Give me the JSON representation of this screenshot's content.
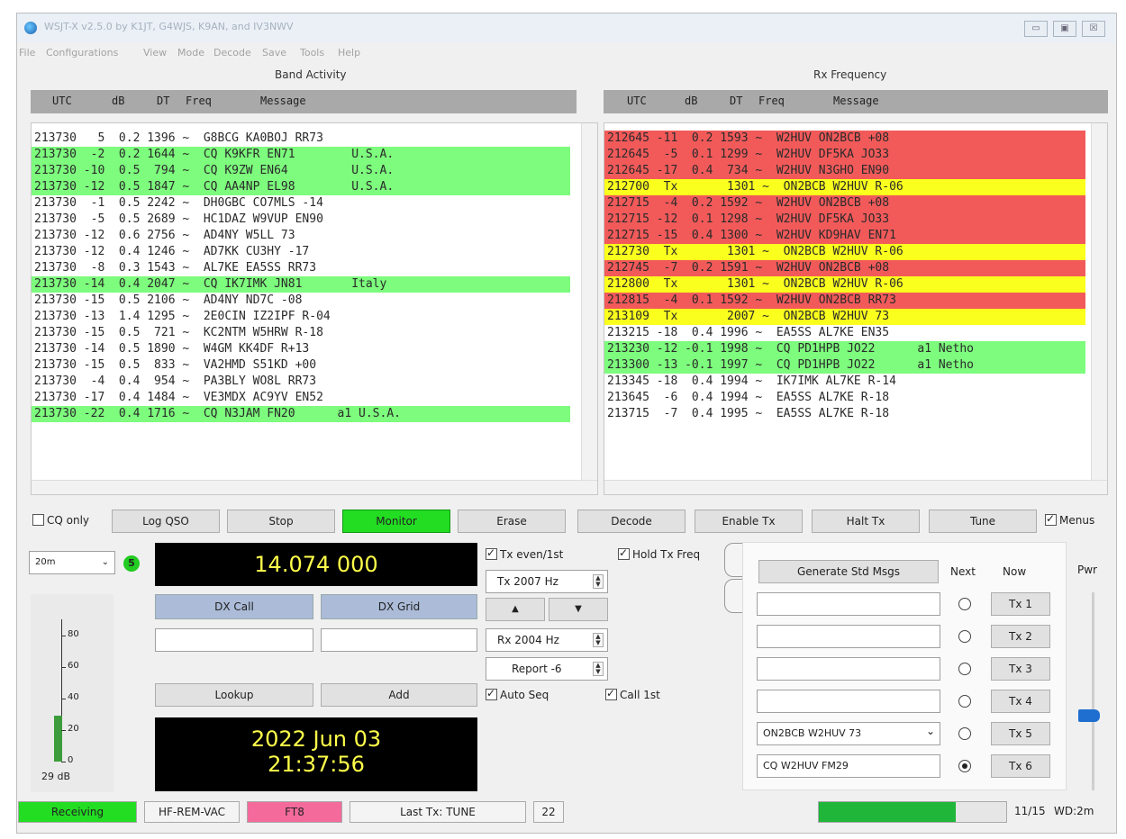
{
  "window": {
    "title": "WSJT-X v2.5.0 by K1JT, G4WJS, K9AN, and IV3NWV",
    "controls": [
      "▭",
      "▣",
      "☒"
    ]
  },
  "menu": [
    "File",
    "Configurations",
    "View",
    "Mode",
    "Decode",
    "Save",
    "Tools",
    "Help"
  ],
  "band_activity": {
    "title": "Band Activity",
    "headers": {
      "utc": "UTC",
      "db": "dB",
      "dt": "DT",
      "freq": "Freq",
      "msg": "Message"
    },
    "rows": [
      {
        "text": "213730   5  0.2 1396 ~  G8BCG KA0BOJ RR73",
        "color": ""
      },
      {
        "text": "213730  -2  0.2 1644 ~  CQ K9KFR EN71        U.S.A.",
        "color": "green"
      },
      {
        "text": "213730 -10  0.5  794 ~  CQ K9ZW EN64         U.S.A.",
        "color": "green"
      },
      {
        "text": "213730 -12  0.5 1847 ~  CQ AA4NP EL98        U.S.A.",
        "color": "green"
      },
      {
        "text": "213730  -1  0.5 2242 ~  DH0GBC CO7MLS -14",
        "color": ""
      },
      {
        "text": "213730  -5  0.5 2689 ~  HC1DAZ W9VUP EN90",
        "color": ""
      },
      {
        "text": "213730 -12  0.6 2756 ~  AD4NY W5LL 73",
        "color": ""
      },
      {
        "text": "213730 -12  0.4 1246 ~  AD7KK CU3HY -17",
        "color": ""
      },
      {
        "text": "213730  -8  0.3 1543 ~  AL7KE EA5SS RR73",
        "color": ""
      },
      {
        "text": "213730 -14  0.4 2047 ~  CQ IK7IMK JN81       Italy",
        "color": "green"
      },
      {
        "text": "213730 -15  0.5 2106 ~  AD4NY ND7C -08",
        "color": ""
      },
      {
        "text": "213730 -13  1.4 1295 ~  2E0CIN IZ2IPF R-04",
        "color": ""
      },
      {
        "text": "213730 -15  0.5  721 ~  KC2NTM W5HRW R-18",
        "color": ""
      },
      {
        "text": "213730 -14  0.5 1890 ~  W4GM KK4DF R+13",
        "color": ""
      },
      {
        "text": "213730 -15  0.5  833 ~  VA2HMD S51KD +00",
        "color": ""
      },
      {
        "text": "213730  -4  0.4  954 ~  PA3BLY WO8L RR73",
        "color": ""
      },
      {
        "text": "213730 -17  0.4 1484 ~  VE3MDX AC9YV EN52",
        "color": ""
      },
      {
        "text": "213730 -22  0.4 1716 ~  CQ N3JAM FN20      a1 U.S.A.",
        "color": "green"
      }
    ]
  },
  "rx_frequency": {
    "title": "Rx Frequency",
    "headers": {
      "utc": "UTC",
      "db": "dB",
      "dt": "DT",
      "freq": "Freq",
      "msg": "Message"
    },
    "rows": [
      {
        "text": "212645 -11  0.2 1593 ~  W2HUV ON2BCB +08",
        "color": "red"
      },
      {
        "text": "212645  -5  0.1 1299 ~  W2HUV DF5KA JO33",
        "color": "red"
      },
      {
        "text": "212645 -17  0.4  734 ~  W2HUV N3GHO EN90",
        "color": "red"
      },
      {
        "text": "212700  Tx       1301 ~  ON2BCB W2HUV R-06",
        "color": "yellow"
      },
      {
        "text": "212715  -4  0.2 1592 ~  W2HUV ON2BCB +08",
        "color": "red"
      },
      {
        "text": "212715 -12  0.1 1298 ~  W2HUV DF5KA JO33",
        "color": "red"
      },
      {
        "text": "212715 -15  0.4 1300 ~  W2HUV KD9HAV EN71",
        "color": "red"
      },
      {
        "text": "212730  Tx       1301 ~  ON2BCB W2HUV R-06",
        "color": "yellow"
      },
      {
        "text": "212745  -7  0.2 1591 ~  W2HUV ON2BCB +08",
        "color": "red"
      },
      {
        "text": "212800  Tx       1301 ~  ON2BCB W2HUV R-06",
        "color": "yellow"
      },
      {
        "text": "212815  -4  0.1 1592 ~  W2HUV ON2BCB RR73",
        "color": "red"
      },
      {
        "text": "213109  Tx       2007 ~  ON2BCB W2HUV 73",
        "color": "yellow"
      },
      {
        "text": "213215 -18  0.4 1996 ~  EA5SS AL7KE EN35",
        "color": ""
      },
      {
        "text": "213230 -12 -0.1 1998 ~  CQ PD1HPB JO22      a1 Netho",
        "color": "green"
      },
      {
        "text": "213300 -13 -0.1 1997 ~  CQ PD1HPB JO22      a1 Netho",
        "color": "green"
      },
      {
        "text": "213345 -18  0.4 1994 ~  IK7IMK AL7KE R-14",
        "color": ""
      },
      {
        "text": "213645  -6  0.4 1994 ~  EA5SS AL7KE R-18",
        "color": ""
      },
      {
        "text": "213715  -7  0.4 1995 ~  EA5SS AL7KE R-18",
        "color": ""
      }
    ]
  },
  "buttons": {
    "cq_only": "CQ only",
    "log_qso": "Log QSO",
    "stop": "Stop",
    "monitor": "Monitor",
    "erase": "Erase",
    "decode": "Decode",
    "enable_tx": "Enable Tx",
    "halt_tx": "Halt Tx",
    "tune": "Tune",
    "menus": "Menus"
  },
  "left_panel": {
    "band": "20m",
    "band_badge": "5",
    "frequency": "14.074 000",
    "dx_call_label": "DX Call",
    "dx_grid_label": "DX Grid",
    "dx_call_value": "",
    "dx_grid_value": "",
    "lookup": "Lookup",
    "add": "Add",
    "date": "2022 Jun 03",
    "time": "21:37:56",
    "meter_ticks": [
      "80",
      "60",
      "40",
      "20",
      "0"
    ],
    "meter_db": "29 dB",
    "meter_level_db": 29
  },
  "mid_panel": {
    "tx_even": "Tx even/1st",
    "hold_tx_freq": "Hold Tx Freq",
    "tx_hz": "Tx  2007  Hz",
    "up": "▲",
    "down": "▼",
    "rx_hz": "Rx  2004  Hz",
    "report": "Report -6",
    "auto_seq": "Auto Seq",
    "call_1st": "Call 1st"
  },
  "tx_panel": {
    "generate": "Generate Std Msgs",
    "next": "Next",
    "now": "Now",
    "messages": [
      {
        "text": "",
        "btn": "Tx 1",
        "selected": false
      },
      {
        "text": "",
        "btn": "Tx 2",
        "selected": false
      },
      {
        "text": "",
        "btn": "Tx 3",
        "selected": false
      },
      {
        "text": "",
        "btn": "Tx 4",
        "selected": false
      },
      {
        "text": "ON2BCB W2HUV 73",
        "btn": "Tx 5",
        "selected": false
      },
      {
        "text": "CQ W2HUV FM29",
        "btn": "Tx 6",
        "selected": true
      }
    ],
    "pwr": "Pwr"
  },
  "status_bar": {
    "receiving": "Receiving",
    "audio": "HF-REM-VAC",
    "mode": "FT8",
    "last_tx": "Last Tx: TUNE",
    "count": "22",
    "progress_fraction": 0.73,
    "period": "11/15",
    "wd": "WD:2m"
  },
  "colors": {
    "green": "#7dfc7d",
    "red": "#f25a5a",
    "yellow": "#fbff1d",
    "monitor": "#22dd22",
    "mode_pink": "#f46a9b",
    "progress": "#1fb63a"
  }
}
